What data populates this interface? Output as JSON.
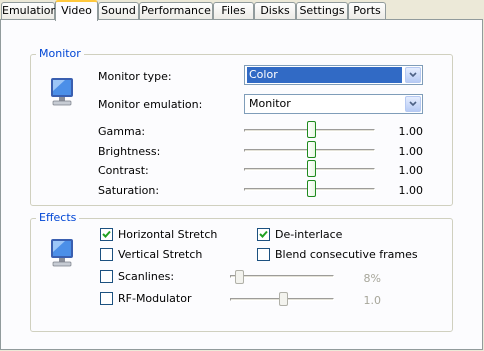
{
  "tabs": [
    {
      "label": "Emulation",
      "active": false
    },
    {
      "label": "Video",
      "active": true
    },
    {
      "label": "Sound",
      "active": false
    },
    {
      "label": "Performance",
      "active": false
    },
    {
      "label": "Files",
      "active": false
    },
    {
      "label": "Disks",
      "active": false
    },
    {
      "label": "Settings",
      "active": false
    },
    {
      "label": "Ports",
      "active": false
    }
  ],
  "monitor": {
    "title": "Monitor",
    "icon": "monitor-icon",
    "type_label": "Monitor type:",
    "type_value": "Color",
    "emulation_label": "Monitor emulation:",
    "emulation_value": "Monitor",
    "sliders": [
      {
        "label": "Gamma:",
        "value": "1.00",
        "level": 0.5
      },
      {
        "label": "Brightness:",
        "value": "1.00",
        "level": 0.5
      },
      {
        "label": "Contrast:",
        "value": "1.00",
        "level": 0.5
      },
      {
        "label": "Saturation:",
        "value": "1.00",
        "level": 0.5
      }
    ]
  },
  "effects": {
    "title": "Effects",
    "icon": "monitor-icon",
    "horizontal_stretch": {
      "label": "Horizontal Stretch",
      "checked": true
    },
    "deinterlace": {
      "label": "De-interlace",
      "checked": true
    },
    "vertical_stretch": {
      "label": "Vertical Stretch",
      "checked": false
    },
    "blend_frames": {
      "label": "Blend consecutive frames",
      "checked": false
    },
    "scanlines": {
      "label": "Scanlines:",
      "checked": false,
      "value": "8%",
      "level": 0.08,
      "enabled": false
    },
    "rf_modulator": {
      "label": "RF-Modulator",
      "checked": false,
      "value": "1.0",
      "level": 0.5,
      "enabled": false
    }
  },
  "colors": {
    "accent": "#0046d5",
    "selection": "#316ac5",
    "tab_highlight": "#ffc83c",
    "check": "#21a121"
  }
}
